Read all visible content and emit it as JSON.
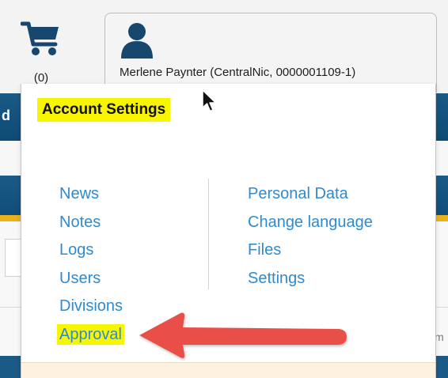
{
  "cart": {
    "icon": "shopping-cart-icon",
    "count": "(0)",
    "color": "#17466e"
  },
  "account": {
    "icon": "user-icon",
    "user_label": "Merlene Paynter (CentralNic, 0000001109-1)"
  },
  "menu": {
    "title": "Account Settings",
    "left_items": [
      {
        "label": "News"
      },
      {
        "label": "Notes"
      },
      {
        "label": "Logs"
      },
      {
        "label": "Users"
      },
      {
        "label": "Divisions"
      },
      {
        "label": "Approval"
      }
    ],
    "right_items": [
      {
        "label": "Personal Data"
      },
      {
        "label": "Change language"
      },
      {
        "label": "Files"
      },
      {
        "label": "Settings"
      }
    ]
  },
  "background": {
    "partial_left_text": "d",
    "partial_right_text": "m"
  },
  "colors": {
    "link": "#2e8bd0",
    "highlight": "#f8f500",
    "annotation_arrow": "#e9504a",
    "header_band": "#1a5a86",
    "accent_stripe": "#e9b21a"
  }
}
